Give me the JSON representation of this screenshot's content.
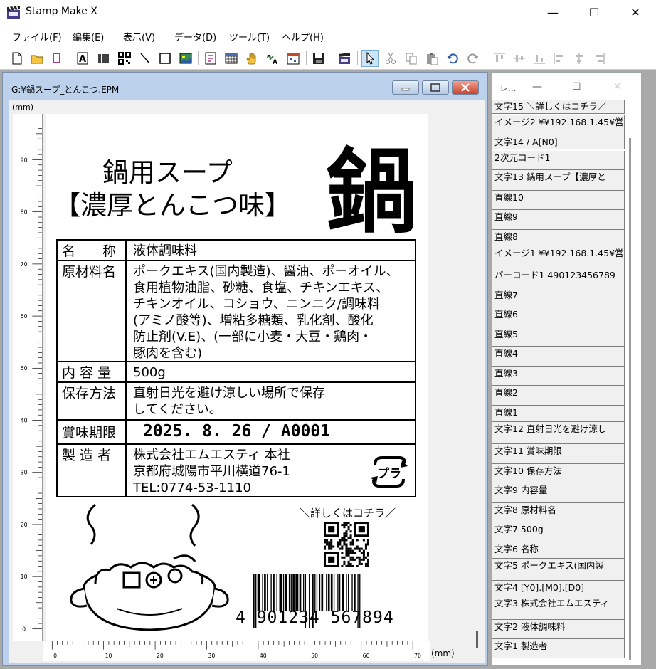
{
  "app": {
    "title": "Stamp Make X",
    "minimize": "—",
    "maximize": "☐",
    "close": "✕"
  },
  "menu": [
    "ファイル(F)",
    "編集(E)",
    "表示(V)",
    "データ(D)",
    "ツール(T)",
    "ヘルプ(H)"
  ],
  "doc": {
    "title": "G:¥鍋スープ_とんこつ.EPM",
    "unit_top": "(mm)",
    "unit_bottom": "(mm)"
  },
  "ruler": {
    "v_labels": [
      "90",
      "80",
      "70",
      "60",
      "50",
      "40",
      "30",
      "20",
      "10",
      "0"
    ],
    "h_labels": [
      "0",
      "10",
      "20",
      "30",
      "40",
      "50",
      "60",
      "70"
    ]
  },
  "label": {
    "title1": "鍋用スープ",
    "title2": "【濃厚とんこつ味】",
    "logo_text": "鍋",
    "name_label": "名　　称",
    "name_value": "液体調味料",
    "ingredients_label": "原材料名",
    "ingredients_lines": [
      "ポークエキス(国内製造)、醤油、ポーオイル、",
      "食用植物油脂、砂糖、食塩、チキンエキス、",
      "チキンオイル、コショウ、ニンニク/調味料",
      "(アミノ酸等)、増粘多糖類、乳化剤、酸化",
      "防止剤(V.E)、(一部に小麦・大豆・鶏肉・",
      "豚肉を含む)"
    ],
    "content_label": "内 容 量",
    "content_value": "500g",
    "storage_label": "保存方法",
    "storage_lines": [
      "直射日光を避け涼しい場所で保存",
      "してください。"
    ],
    "date_label": "賞味期限",
    "date_value": "2025. 8. 26 / A0001",
    "maker_label": "製 造 者",
    "maker_lines": [
      "株式会社エムエスティ 本社",
      "京都府城陽市平川横道76-1",
      "TEL:0774-53-1110"
    ],
    "recycle_text": "プラ",
    "qr_caption": "＼詳しくはコチラ／",
    "barcode_digits": "4 901234 567894"
  },
  "layer_window": {
    "title": "レ...",
    "min": "—",
    "max": "☐",
    "close": "✕"
  },
  "layers": [
    "文字15 ＼詳しくはコチラ／",
    "イメージ2 ¥¥192.168.1.45¥営",
    "文字14 / A[N0]",
    "2次元コード1",
    "文字13 鍋用スープ【濃厚と",
    "直線10",
    "直線9",
    "直線8",
    "イメージ1 ¥¥192.168.1.45¥営",
    "バーコード1 490123456789",
    "直線7",
    "直線6",
    "直線5",
    "直線4",
    "直線3",
    "直線2",
    "直線1",
    "文字12 直射日光を避け涼し",
    "文字11 賞味期限",
    "文字10 保存方法",
    "文字9 内容量",
    "文字8 原材料名",
    "文字7 500g",
    "文字6 名称",
    "文字5 ポークエキス(国内製",
    "文字4 [Y0].[M0].[D0]",
    "文字3 株式会社エムエスティ",
    "文字2 液体調味料",
    "文字1 製造者"
  ],
  "colors": {
    "accent": "#cce4f7",
    "mdi_title": "#bcd2ec",
    "close_red": "#c8462c"
  }
}
